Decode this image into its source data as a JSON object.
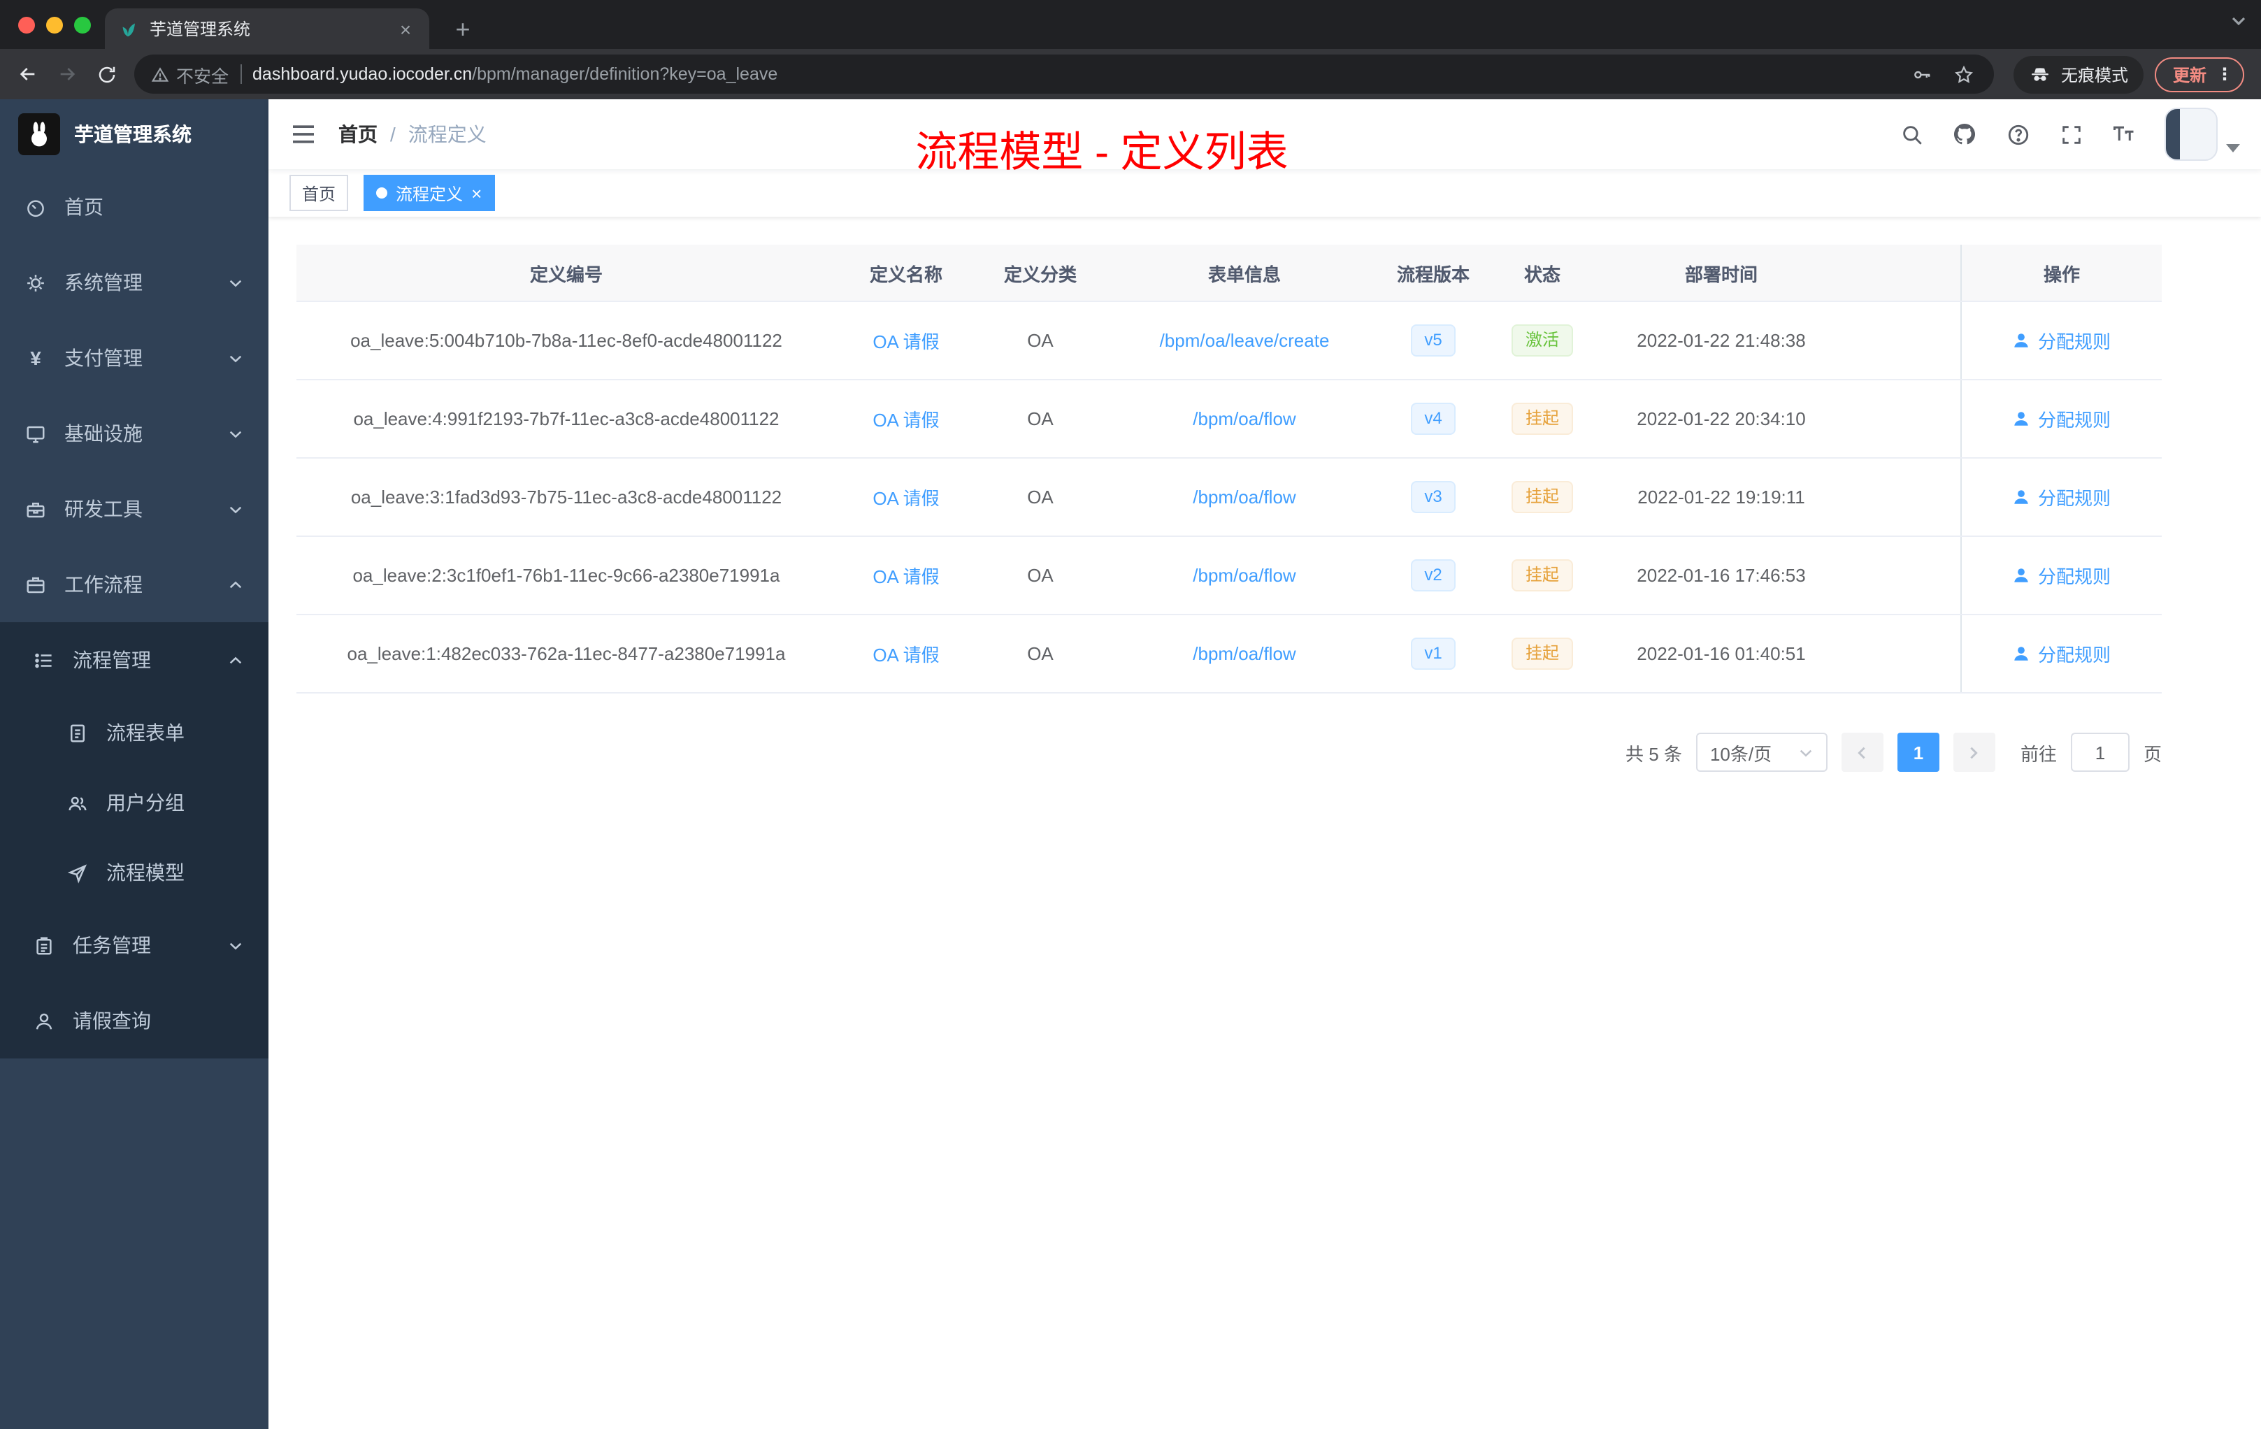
{
  "colors": {
    "accent": "#409eff",
    "success": "#67c23a",
    "warning": "#e6a23c",
    "annotation_red": "#ff0000",
    "sidebar_bg": "#304156",
    "submenu_bg": "#1f2d3d",
    "active_tag_bg": "#409eff"
  },
  "browser": {
    "tab_title": "芋道管理系统",
    "security_label": "不安全",
    "url_host": "dashboard.yudao.iocoder.cn",
    "url_path": "/bpm/manager/definition?key=oa_leave",
    "incognito_label": "无痕模式",
    "update_label": "更新"
  },
  "sidebar": {
    "logo_title": "芋道管理系统",
    "items": {
      "home": "首页",
      "system": "系统管理",
      "payment": "支付管理",
      "infra": "基础设施",
      "devtools": "研发工具",
      "workflow": "工作流程",
      "process_mgmt": "流程管理",
      "process_form": "流程表单",
      "user_group": "用户分组",
      "process_model": "流程模型",
      "task_mgmt": "任务管理",
      "leave_query": "请假查询"
    }
  },
  "header": {
    "breadcrumb_home": "首页",
    "breadcrumb_sep": "/",
    "breadcrumb_current": "流程定义",
    "annotation": "流程模型 - 定义列表"
  },
  "tags": {
    "home": "首页",
    "active": "流程定义",
    "close": "×"
  },
  "table": {
    "columns": [
      "定义编号",
      "定义名称",
      "定义分类",
      "表单信息",
      "流程版本",
      "状态",
      "部署时间",
      "操作"
    ],
    "rows": [
      {
        "id": "oa_leave:5:004b710b-7b8a-11ec-8ef0-acde48001122",
        "name": "OA 请假",
        "category": "OA",
        "form": "/bpm/oa/leave/create",
        "version": "v5",
        "status": "激活",
        "status_type": "success",
        "deploy_time": "2022-01-22 21:48:38",
        "action": "分配规则"
      },
      {
        "id": "oa_leave:4:991f2193-7b7f-11ec-a3c8-acde48001122",
        "name": "OA 请假",
        "category": "OA",
        "form": "/bpm/oa/flow",
        "version": "v4",
        "status": "挂起",
        "status_type": "warning",
        "deploy_time": "2022-01-22 20:34:10",
        "action": "分配规则"
      },
      {
        "id": "oa_leave:3:1fad3d93-7b75-11ec-a3c8-acde48001122",
        "name": "OA 请假",
        "category": "OA",
        "form": "/bpm/oa/flow",
        "version": "v3",
        "status": "挂起",
        "status_type": "warning",
        "deploy_time": "2022-01-22 19:19:11",
        "action": "分配规则"
      },
      {
        "id": "oa_leave:2:3c1f0ef1-76b1-11ec-9c66-a2380e71991a",
        "name": "OA 请假",
        "category": "OA",
        "form": "/bpm/oa/flow",
        "version": "v2",
        "status": "挂起",
        "status_type": "warning",
        "deploy_time": "2022-01-16 17:46:53",
        "action": "分配规则"
      },
      {
        "id": "oa_leave:1:482ec033-762a-11ec-8477-a2380e71991a",
        "name": "OA 请假",
        "category": "OA",
        "form": "/bpm/oa/flow",
        "version": "v1",
        "status": "挂起",
        "status_type": "warning",
        "deploy_time": "2022-01-16 01:40:51",
        "action": "分配规则"
      }
    ]
  },
  "pagination": {
    "total": "共 5 条",
    "page_size": "10条/页",
    "page": "1",
    "goto_label": "前往",
    "goto_value": "1",
    "unit_label": "页"
  }
}
